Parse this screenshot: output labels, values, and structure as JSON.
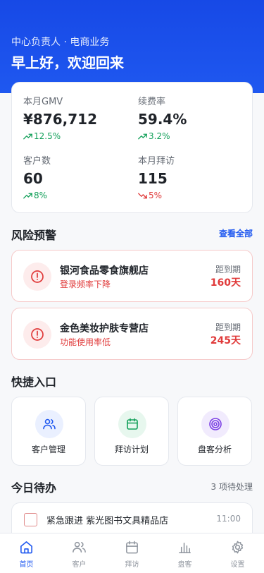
{
  "header": {
    "subtitle": "中心负责人 · 电商业务",
    "greeting": "早上好，欢迎回来"
  },
  "stats": [
    {
      "label": "本月GMV",
      "value": "¥876,712",
      "change": "12.5%",
      "trend": "up"
    },
    {
      "label": "续费率",
      "value": "59.4%",
      "change": "3.2%",
      "trend": "up"
    },
    {
      "label": "客户数",
      "value": "60",
      "change": "8%",
      "trend": "up"
    },
    {
      "label": "本月拜访",
      "value": "115",
      "change": "5%",
      "trend": "down"
    }
  ],
  "risk": {
    "title": "风险预警",
    "view_all": "查看全部",
    "items": [
      {
        "name": "银河食品零食旗舰店",
        "reason": "登录频率下降",
        "due_label": "距到期",
        "due_value": "160天"
      },
      {
        "name": "金色美妆护肤专营店",
        "reason": "功能使用率低",
        "due_label": "距到期",
        "due_value": "245天"
      }
    ]
  },
  "quick": {
    "title": "快捷入口",
    "items": [
      {
        "label": "客户管理",
        "icon": "users-icon",
        "color": "#1f58f0"
      },
      {
        "label": "拜访计划",
        "icon": "calendar-icon",
        "color": "#13a05a"
      },
      {
        "label": "盘客分析",
        "icon": "target-icon",
        "color": "#7b3fe4"
      }
    ]
  },
  "todo": {
    "title": "今日待办",
    "count": "3 项待处理",
    "items": [
      {
        "text": "紧急跟进 紫光图书文具精品店",
        "time": "11:00"
      }
    ]
  },
  "tabs": [
    {
      "label": "首页",
      "icon": "home-icon",
      "active": true
    },
    {
      "label": "客户",
      "icon": "users-icon",
      "active": false
    },
    {
      "label": "拜访",
      "icon": "calendar-icon",
      "active": false
    },
    {
      "label": "盘客",
      "icon": "bar-chart-icon",
      "active": false
    },
    {
      "label": "设置",
      "icon": "gear-icon",
      "active": false
    }
  ],
  "colors": {
    "brand": "#1f58f0",
    "up": "#13a05a",
    "down": "#e03a3a"
  }
}
